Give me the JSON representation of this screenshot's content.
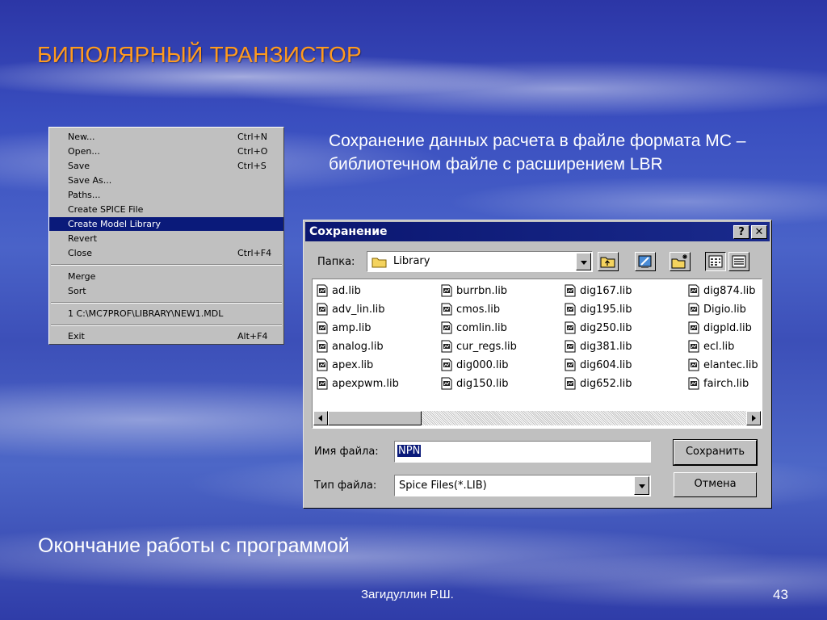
{
  "slide": {
    "title": "БИПОЛЯРНЫЙ ТРАНЗИСТОР",
    "body_text": "Сохранение данных расчета в файле формата МС – библиотечном файле с расширением LBR",
    "bottom_text": "Окончание работы с программой",
    "author": "Загидуллин Р.Ш.",
    "page_number": "43"
  },
  "menu": {
    "items": [
      {
        "label": "New...",
        "shortcut": "Ctrl+N"
      },
      {
        "label": "Open...",
        "shortcut": "Ctrl+O"
      },
      {
        "label": "Save",
        "shortcut": "Ctrl+S"
      },
      {
        "label": "Save As...",
        "shortcut": ""
      },
      {
        "label": "Paths...",
        "shortcut": ""
      },
      {
        "label": "Create SPICE File",
        "shortcut": ""
      },
      {
        "label": "Create Model Library",
        "shortcut": "",
        "selected": true
      },
      {
        "label": "Revert",
        "shortcut": ""
      },
      {
        "label": "Close",
        "shortcut": "Ctrl+F4"
      },
      {
        "label": "Merge",
        "shortcut": ""
      },
      {
        "label": "Sort",
        "shortcut": ""
      },
      {
        "label": "1 C:\\MC7PROF\\LIBRARY\\NEW1.MDL",
        "shortcut": ""
      },
      {
        "label": "Exit",
        "shortcut": "Alt+F4"
      }
    ]
  },
  "dialog": {
    "title": "Сохранение",
    "help_button": "?",
    "close_button": "✕",
    "folder_label": "Папка:",
    "folder_value": "Library",
    "files": [
      "ad.lib",
      "adv_lin.lib",
      "amp.lib",
      "analog.lib",
      "apex.lib",
      "apexpwm.lib",
      "burrbn.lib",
      "cmos.lib",
      "comlin.lib",
      "cur_regs.lib",
      "dig000.lib",
      "dig150.lib",
      "dig167.lib",
      "dig195.lib",
      "dig250.lib",
      "dig381.lib",
      "dig604.lib",
      "dig652.lib",
      "dig874.lib",
      "Digio.lib",
      "digpld.lib",
      "ecl.lib",
      "elantec.lib",
      "fairch.lib"
    ],
    "filename_label": "Имя файла:",
    "filename_value": "NPN",
    "filetype_label": "Тип файла:",
    "filetype_value": "Spice Files(*.LIB)",
    "save_button": "Сохранить",
    "cancel_button": "Отмена"
  },
  "colors": {
    "title_orange": "#ff9a1f",
    "selection_blue": "#0a1a7a",
    "dialog_gray": "#c0c0c0"
  }
}
